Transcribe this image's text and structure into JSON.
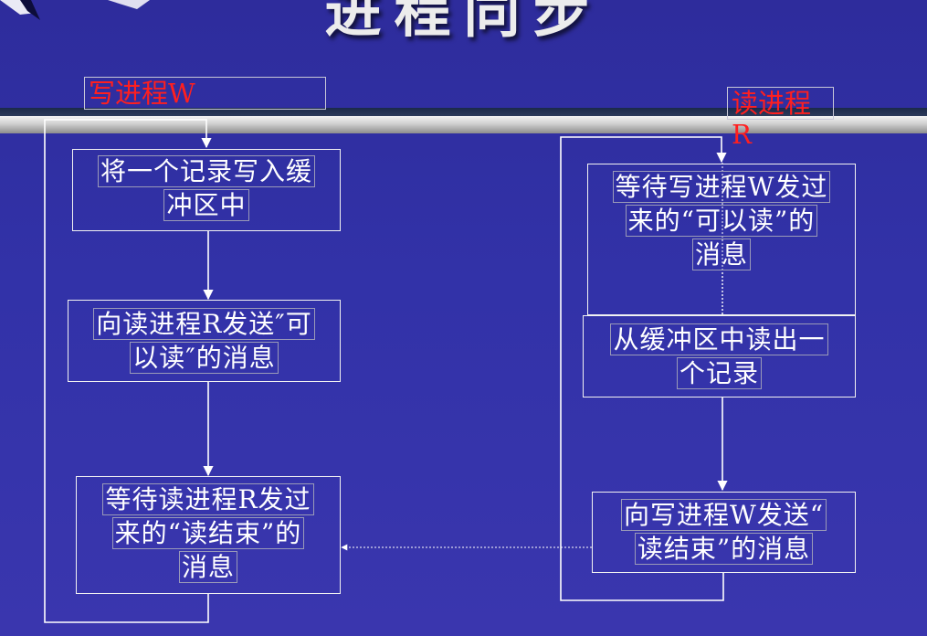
{
  "title": "进程同步",
  "writer": {
    "label": "写进程W",
    "box1": [
      "将一个记录写入缓",
      "冲区中"
    ],
    "box2": [
      "向读进程R发送″可",
      "以读″的消息"
    ],
    "box3": [
      "等待读进程R发过",
      "来的“读结束”的",
      "消息"
    ]
  },
  "reader": {
    "label": "读进程R",
    "box1": [
      "等待写进程W发过",
      "来的“可以读”的",
      "消息"
    ],
    "box2": [
      "从缓冲区中读出一",
      "个记录"
    ],
    "box3": [
      "向写进程W发送“",
      "读结束”的消息"
    ]
  },
  "colors": {
    "background": "#3232a8",
    "label": "#ff1f1f",
    "line": "#ffffff"
  }
}
